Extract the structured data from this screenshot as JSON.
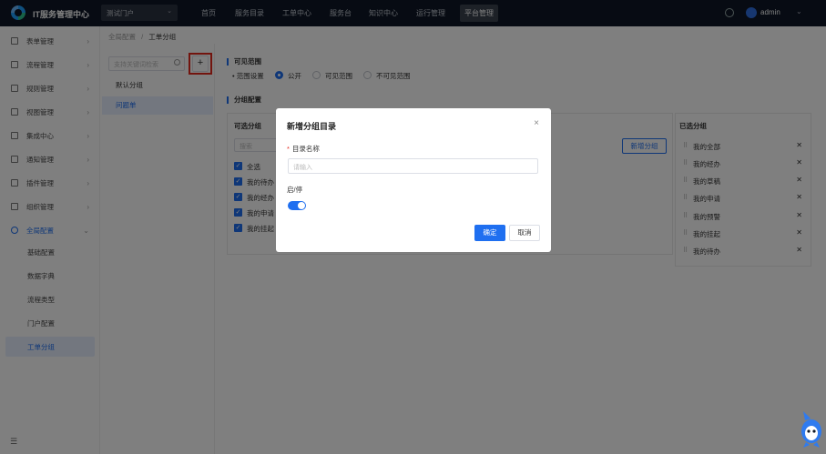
{
  "topbar": {
    "app_title": "IT服务管理中心",
    "portal_select": "测试门户",
    "nav": [
      "首页",
      "服务目录",
      "工单中心",
      "服务台",
      "知识中心",
      "运行管理",
      "平台管理"
    ],
    "active_nav": "平台管理",
    "user": "admin"
  },
  "sidebar": {
    "items": [
      {
        "label": "表单管理",
        "icon": "form-icon"
      },
      {
        "label": "流程管理",
        "icon": "flow-icon"
      },
      {
        "label": "规则管理",
        "icon": "rule-icon"
      },
      {
        "label": "视图管理",
        "icon": "view-icon"
      },
      {
        "label": "集成中心",
        "icon": "integration-icon"
      },
      {
        "label": "通知管理",
        "icon": "bell-icon"
      },
      {
        "label": "插件管理",
        "icon": "plugin-icon"
      },
      {
        "label": "组织管理",
        "icon": "org-icon"
      },
      {
        "label": "全局配置",
        "icon": "settings-icon"
      }
    ],
    "sub_items": [
      "基础配置",
      "数据字典",
      "流程类型",
      "门户配置",
      "工单分组"
    ],
    "active_sub": "工单分组"
  },
  "breadcrumb": {
    "parent": "全局配置",
    "sep": "/",
    "current": "工单分组"
  },
  "group_panel": {
    "search_placeholder": "支持关键词检索",
    "add_label": "+",
    "groups": [
      "默认分组",
      "问题单"
    ],
    "active_group": "问题单"
  },
  "visible_range": {
    "section_title": "可见范围",
    "field_label": "• 范围设置",
    "options": [
      "公开",
      "可见范围",
      "不可见范围"
    ],
    "selected": "公开"
  },
  "group_config": {
    "section_title": "分组配置",
    "available_title": "可选分组",
    "search_placeholder": "搜索",
    "new_group_button": "新增分组",
    "available_items": [
      "全选",
      "我的待办",
      "我的经办",
      "我的申请",
      "我的挂起"
    ],
    "selected_title": "已选分组",
    "selected_items": [
      "我的全部",
      "我的经办",
      "我的草稿",
      "我的申请",
      "我的预警",
      "我的挂起",
      "我的待办"
    ]
  },
  "modal": {
    "title": "新增分组目录",
    "close": "×",
    "name_label": "目录名称",
    "required_mark": "*",
    "name_placeholder": "请输入",
    "toggle_label": "启/停",
    "toggle_on": true,
    "ok_button": "确定",
    "cancel_button": "取消"
  },
  "colors": {
    "accent": "#1f6ff0",
    "topbar": "#0e1726",
    "highlight_ring": "#e5291d"
  }
}
